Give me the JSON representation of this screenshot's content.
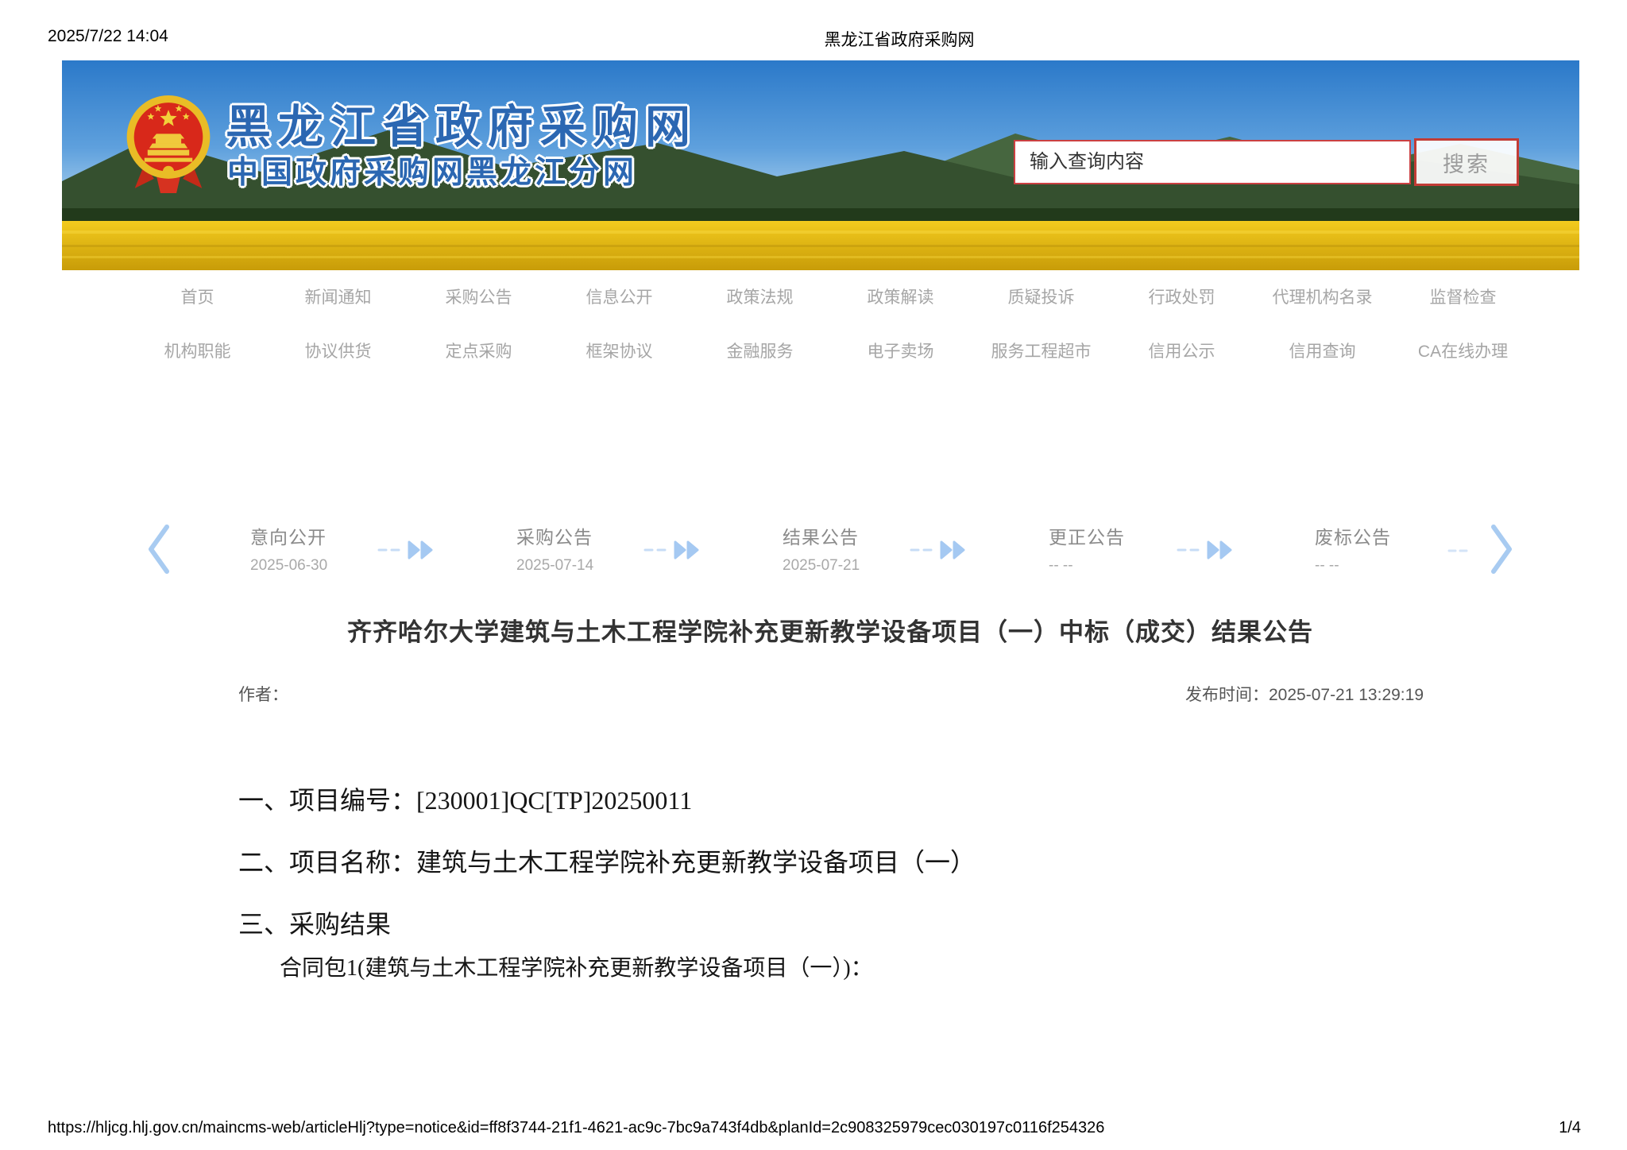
{
  "print_header": {
    "datetime": "2025/7/22 14:04",
    "title": "黑龙江省政府采购网"
  },
  "colors": {
    "brand_blue": "#2b67b2",
    "accent_red": "#c23c36",
    "timeline_blue": "#a5c9f2",
    "nav_gray": "#a6a6a6"
  },
  "banner": {
    "site_title": "黑龙江省政府采购网",
    "site_subtitle": "中国政府采购网黑龙江分网",
    "emblem_icon": "prc-national-emblem",
    "search": {
      "placeholder": "输入查询内容",
      "button_label": "搜索"
    }
  },
  "nav": {
    "row1": [
      "首页",
      "新闻通知",
      "采购公告",
      "信息公开",
      "政策法规",
      "政策解读",
      "质疑投诉",
      "行政处罚",
      "代理机构名录",
      "监督检查"
    ],
    "row2": [
      "机构职能",
      "协议供货",
      "定点采购",
      "框架协议",
      "金融服务",
      "电子卖场",
      "服务工程超市",
      "信用公示",
      "信用查询",
      "CA在线办理"
    ]
  },
  "timeline": {
    "steps": [
      {
        "label": "意向公开",
        "date": "2025-06-30"
      },
      {
        "label": "采购公告",
        "date": "2025-07-14"
      },
      {
        "label": "结果公告",
        "date": "2025-07-21"
      },
      {
        "label": "更正公告",
        "date": "-- --"
      },
      {
        "label": "废标公告",
        "date": "-- --"
      }
    ]
  },
  "article": {
    "title": "齐齐哈尔大学建筑与土木工程学院补充更新教学设备项目（一）中标（成交）结果公告",
    "author": "作者：",
    "publish_time": "发布时间：2025-07-21 13:29:19",
    "paragraphs": [
      "一、项目编号：[230001]QC[TP]20250011",
      "二、项目名称：建筑与土木工程学院补充更新教学设备项目（一）",
      "三、采购结果",
      "合同包1(建筑与土木工程学院补充更新教学设备项目（一）)："
    ]
  },
  "print_footer": {
    "url": "https://hljcg.hlj.gov.cn/maincms-web/articleHlj?type=notice&id=ff8f3744-21f1-4621-ac9c-7bc9a743f4db&planId=2c908325979cec030197c0116f254326",
    "page": "1/4"
  }
}
